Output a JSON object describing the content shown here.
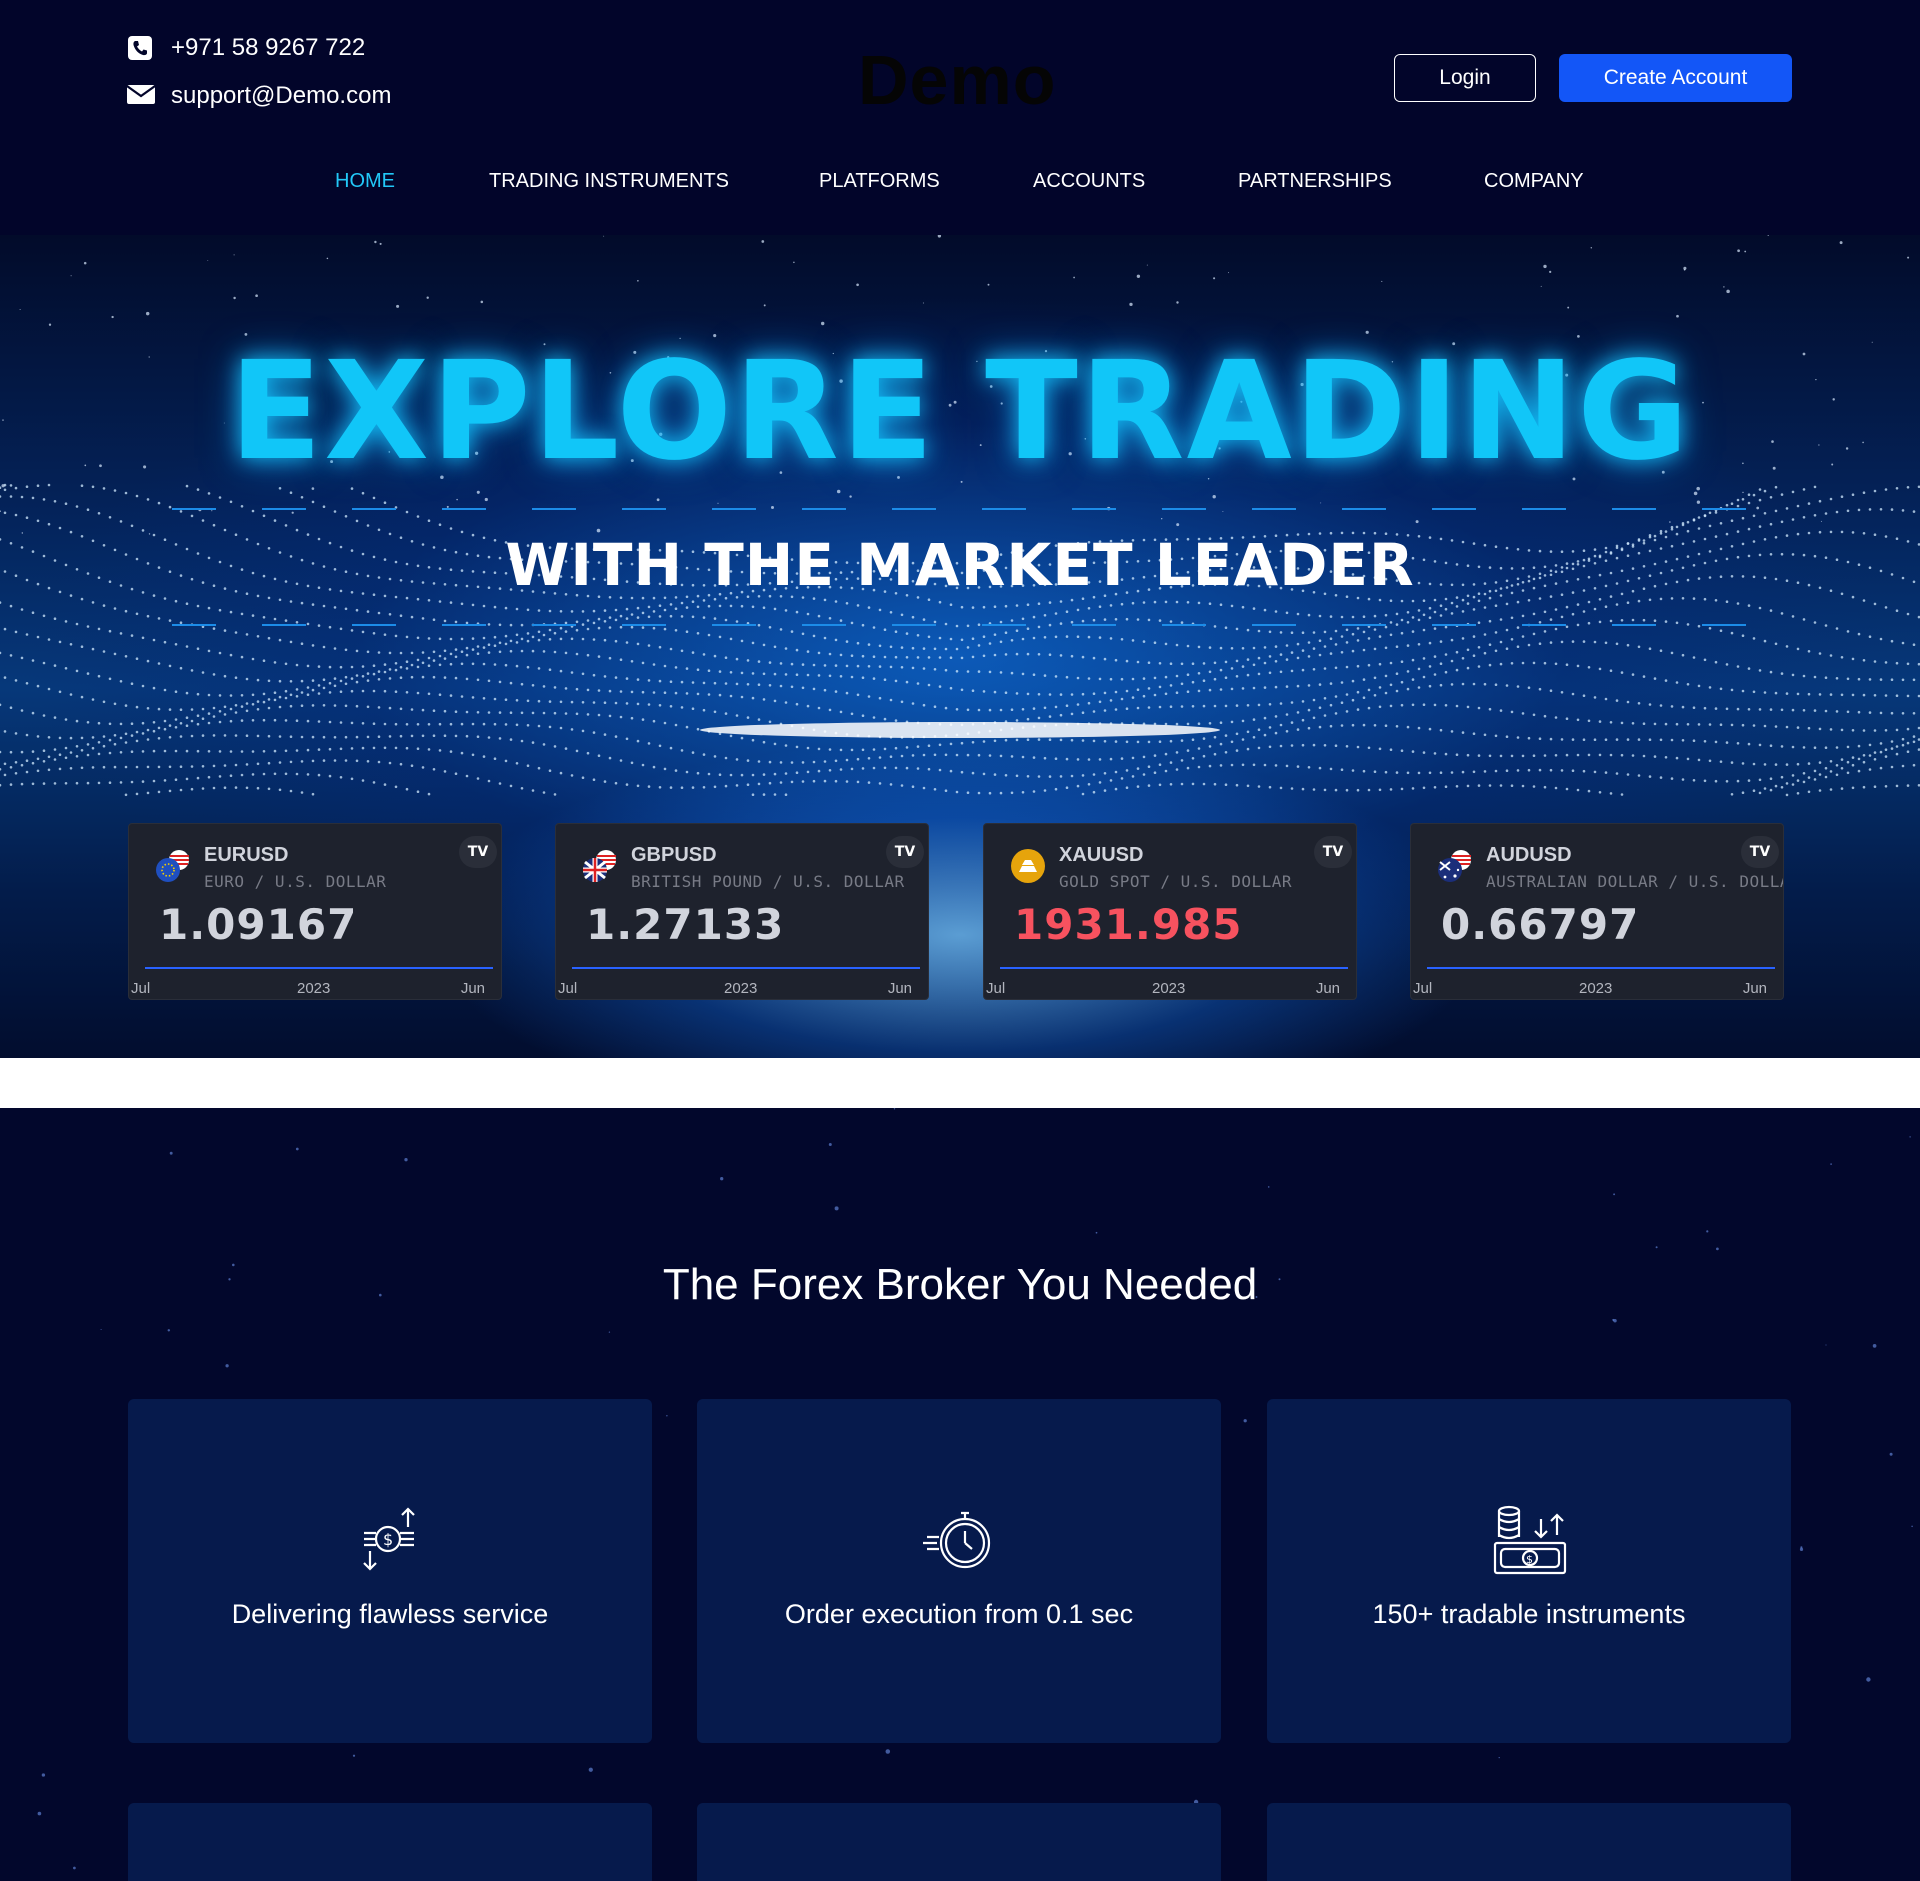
{
  "header": {
    "phone": "+971 58 9267 722",
    "email": "support@Demo.com",
    "logo": "Demo",
    "login_label": "Login",
    "create_account_label": "Create Account",
    "icons": {
      "phone": "phone-icon",
      "email": "envelope-icon"
    },
    "colors": {
      "background": "#02052a",
      "primary_button": "#1356f7",
      "active_nav": "#22c8f8"
    }
  },
  "nav": {
    "items": [
      {
        "label": "HOME",
        "active": true
      },
      {
        "label": "TRADING INSTRUMENTS",
        "active": false
      },
      {
        "label": "PLATFORMS",
        "active": false
      },
      {
        "label": "ACCOUNTS",
        "active": false
      },
      {
        "label": "PARTNERSHIPS",
        "active": false
      },
      {
        "label": "COMPANY",
        "active": false
      }
    ]
  },
  "hero": {
    "title": "EXPLORE TRADING",
    "subtitle": "WITH THE MARKET LEADER",
    "title_color": "#11c6f8"
  },
  "tickers": [
    {
      "symbol": "EURUSD",
      "description": "EURO / U.S. DOLLAR",
      "price": "1.09167",
      "price_color": "#d1d4dc",
      "flag": "eu-us-flag-icon",
      "axis": [
        "Jul",
        "2023",
        "Jun"
      ]
    },
    {
      "symbol": "GBPUSD",
      "description": "BRITISH POUND / U.S. DOLLAR",
      "price": "1.27133",
      "price_color": "#d1d4dc",
      "flag": "gb-us-flag-icon",
      "axis": [
        "Jul",
        "2023",
        "Jun"
      ]
    },
    {
      "symbol": "XAUUSD",
      "description": "GOLD SPOT / U.S. DOLLAR",
      "price": "1931.985",
      "price_color": "#f7525f",
      "flag": "gold-icon",
      "axis": [
        "Jul",
        "2023",
        "Jun"
      ]
    },
    {
      "symbol": "AUDUSD",
      "description": "AUSTRALIAN DOLLAR / U.S. DOLLAR",
      "price": "0.66797",
      "price_color": "#d1d4dc",
      "flag": "au-us-flag-icon",
      "axis": [
        "Jul",
        "2023",
        "Jun"
      ]
    }
  ],
  "ticker_badge": "TV",
  "features": {
    "title": "The Forex Broker You Needed",
    "cards": [
      {
        "label": "Delivering flawless service",
        "icon": "money-exchange-icon"
      },
      {
        "label": "Order execution from 0.1 sec",
        "icon": "stopwatch-icon"
      },
      {
        "label": "150+ tradable instruments",
        "icon": "cash-coins-icon"
      }
    ],
    "card_color": "#061a4c"
  }
}
